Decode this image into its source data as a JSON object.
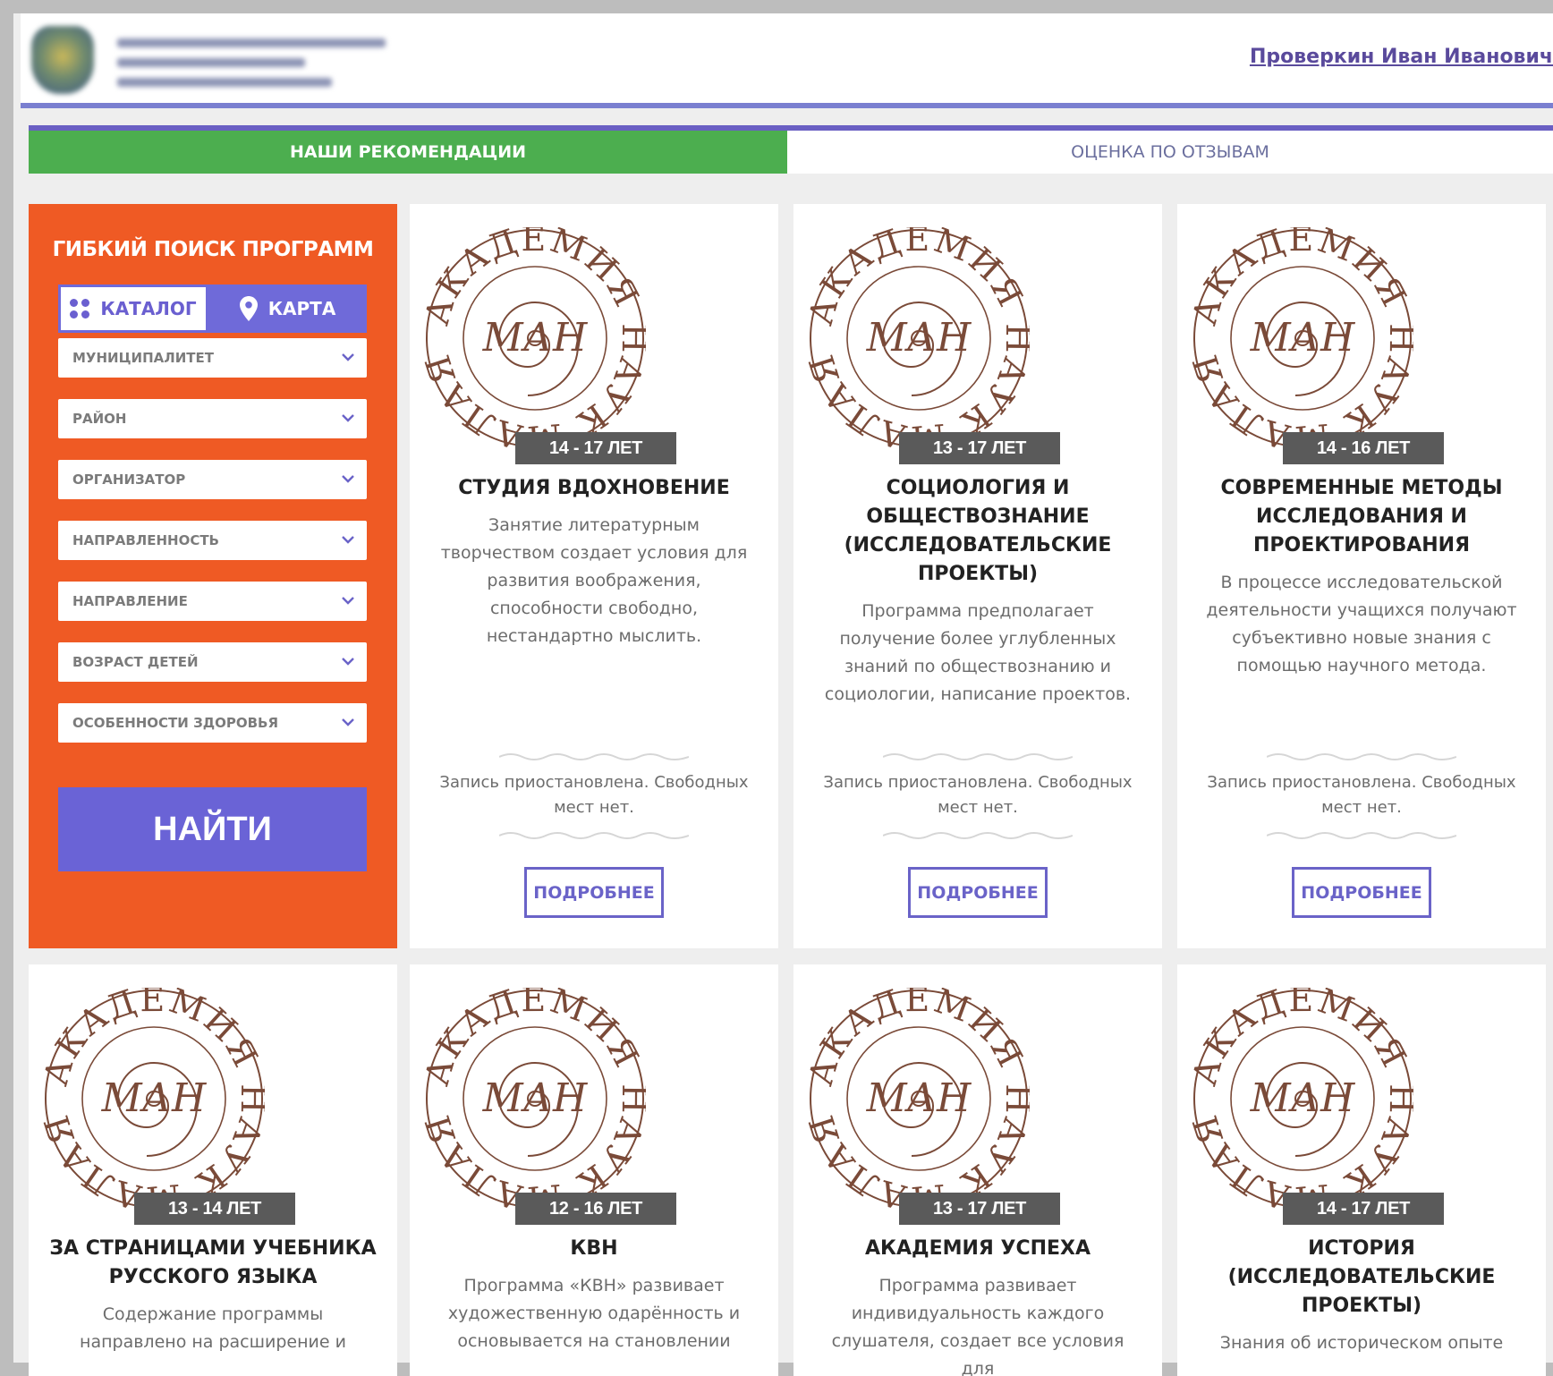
{
  "header": {
    "user_name": "Проверкин Иван Иванович"
  },
  "tabs": [
    {
      "label": "НАШИ РЕКОМЕНДАЦИИ",
      "active": true
    },
    {
      "label": "ОЦЕНКА ПО ОТЗЫВАМ",
      "active": false
    }
  ],
  "search": {
    "title": "ГИБКИЙ ПОИСК ПРОГРАММ",
    "catalog_label": "КАТАЛОГ",
    "map_label": "КАРТА",
    "filters": [
      "МУНИЦИПАЛИТЕТ",
      "РАЙОН",
      "ОРГАНИЗАТОР",
      "НАПРАВЛЕННОСТЬ",
      "НАПРАВЛЕНИЕ",
      "ВОЗРАСТ ДЕТЕЙ",
      "ОСОБЕННОСТИ ЗДОРОВЬЯ"
    ],
    "find_label": "НАЙТИ"
  },
  "seal_text": {
    "ring": "АКАДЕМИЯ НАУК МАЛАЯ",
    "center": "МАН"
  },
  "cards": [
    {
      "age": "14 - 17 ЛЕТ",
      "title": "СТУДИЯ ВДОХНОВЕНИЕ",
      "description": "Занятие литературным творчеством создает условия для развития воображения, способности свободно, нестандартно мыслить.",
      "status": "Запись приостановлена. Свободных мест нет.",
      "button": "ПОДРОБНЕЕ"
    },
    {
      "age": "13 - 17 ЛЕТ",
      "title": "СОЦИОЛОГИЯ И ОБЩЕСТВОЗНАНИЕ (ИССЛЕДОВАТЕЛЬСКИЕ ПРОЕКТЫ)",
      "description": "Программа предполагает получение более углубленных знаний по обществознанию и социологии, написание проектов.",
      "status": "Запись приостановлена. Свободных мест нет.",
      "button": "ПОДРОБНЕЕ"
    },
    {
      "age": "14 - 16 ЛЕТ",
      "title": "СОВРЕМЕННЫЕ МЕТОДЫ ИССЛЕДОВАНИЯ И ПРОЕКТИРОВАНИЯ",
      "description": "В процессе исследовательской деятельности учащихся получают субъективно новые знания с помощью научного метода.",
      "status": "Запись приостановлена. Свободных мест нет.",
      "button": "ПОДРОБНЕЕ"
    },
    {
      "age": "13 - 14 ЛЕТ",
      "title": "ЗА СТРАНИЦАМИ УЧЕБНИКА РУССКОГО ЯЗЫКА",
      "description": "Содержание программы направлено на расширение и",
      "status": "",
      "button": ""
    },
    {
      "age": "12 - 16 ЛЕТ",
      "title": "КВН",
      "description": "Программа «КВН» развивает художественную одарённость и основывается на становлении",
      "status": "",
      "button": ""
    },
    {
      "age": "13 - 17 ЛЕТ",
      "title": "АКАДЕМИЯ УСПЕХА",
      "description": "Программа развивает индивидуальность каждого слушателя, создает все условия для",
      "status": "",
      "button": ""
    },
    {
      "age": "14 - 17 ЛЕТ",
      "title": "ИСТОРИЯ (ИССЛЕДОВАТЕЛЬСКИЕ ПРОЕКТЫ)",
      "description": "Знания об историческом опыте",
      "status": "",
      "button": ""
    }
  ],
  "colors": {
    "accent_green": "#4cae4f",
    "accent_orange": "#ef5a24",
    "accent_purple": "#6a63d6",
    "seal_brown": "#7a4a38"
  }
}
